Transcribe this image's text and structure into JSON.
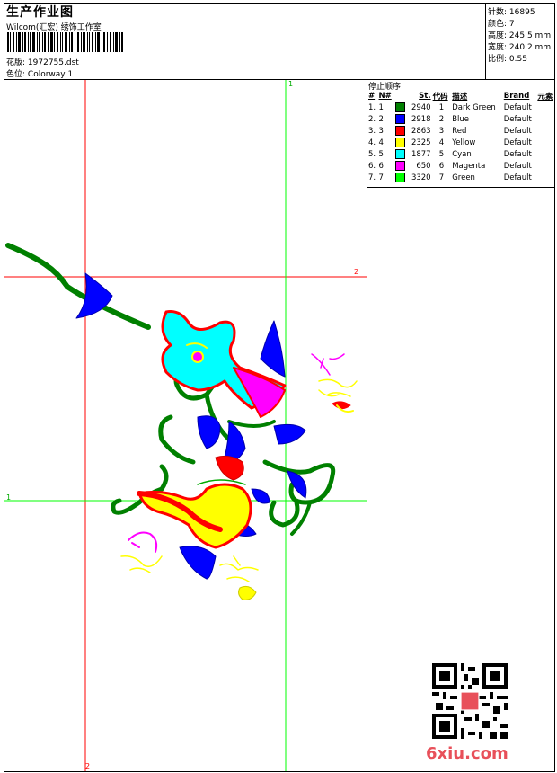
{
  "header": {
    "title": "生产作业图",
    "company": "Wilcom(汇宏) 绣饰工作室",
    "design_label": "花版:",
    "design_value": "1972755.dst",
    "colorway_label": "色位:",
    "colorway_value": "Colorway 1"
  },
  "stats": [
    {
      "label": "针数:",
      "value": "16895"
    },
    {
      "label": "颜色:",
      "value": "7"
    },
    {
      "label": "高度:",
      "value": "245.5 mm"
    },
    {
      "label": "宽度:",
      "value": "240.2 mm"
    },
    {
      "label": "比例:",
      "value": "0.55"
    }
  ],
  "color_order": {
    "title": "停止顺序:",
    "headers": [
      "#",
      "N#",
      "St.",
      "代码",
      "描述",
      "Brand",
      "元素"
    ],
    "rows": [
      {
        "num": "1.",
        "n": "1",
        "color": "#008000",
        "stitches": "2940",
        "code": "1",
        "desc": "Dark Green",
        "brand": "Default"
      },
      {
        "num": "2.",
        "n": "2",
        "color": "#0000ff",
        "stitches": "2918",
        "code": "2",
        "desc": "Blue",
        "brand": "Default"
      },
      {
        "num": "3.",
        "n": "3",
        "color": "#ff0000",
        "stitches": "2863",
        "code": "3",
        "desc": "Red",
        "brand": "Default"
      },
      {
        "num": "4.",
        "n": "4",
        "color": "#ffff00",
        "stitches": "2325",
        "code": "4",
        "desc": "Yellow",
        "brand": "Default"
      },
      {
        "num": "5.",
        "n": "5",
        "color": "#00ffff",
        "stitches": "1877",
        "code": "5",
        "desc": "Cyan",
        "brand": "Default"
      },
      {
        "num": "6.",
        "n": "6",
        "color": "#ff00ff",
        "stitches": "650",
        "code": "6",
        "desc": "Magenta",
        "brand": "Default"
      },
      {
        "num": "7.",
        "n": "7",
        "color": "#00ff00",
        "stitches": "3320",
        "code": "7",
        "desc": "Green",
        "brand": "Default"
      }
    ]
  },
  "guides": {
    "red_label_1": "2",
    "red_label_2": "2",
    "green_label_1": "1",
    "green_label_2": "1"
  },
  "watermark": "6xiu.com"
}
